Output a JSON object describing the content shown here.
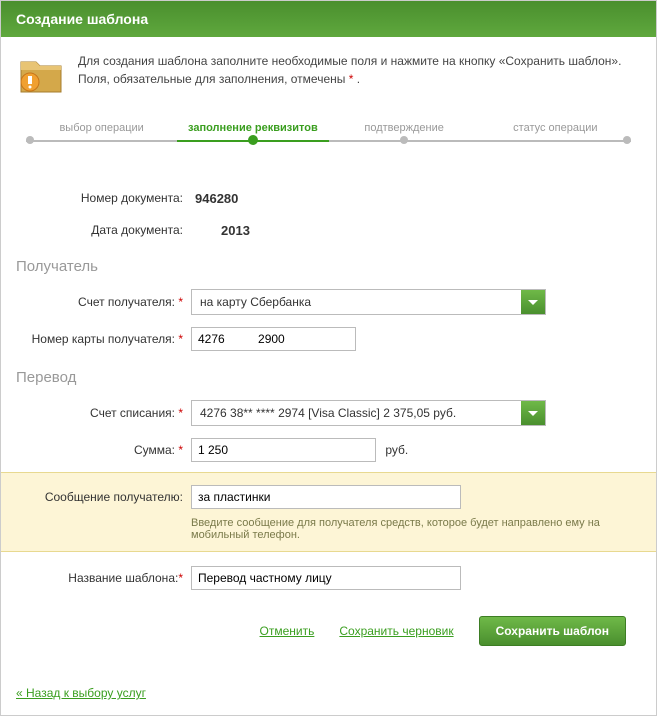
{
  "header": {
    "title": "Создание шаблона"
  },
  "intro": {
    "line1": "Для создания шаблона заполните необходимые поля и нажмите на кнопку «Сохранить шаблон».",
    "line2_a": "Поля, обязательные для заполнения, отмечены ",
    "line2_b": "*",
    "line2_c": " ."
  },
  "steps": {
    "s1": "выбор операции",
    "s2": "заполнение реквизитов",
    "s3": "подтверждение",
    "s4": "статус операции"
  },
  "form": {
    "doc_number_label": "Номер документа:",
    "doc_number_value": "946280",
    "doc_date_label": "Дата документа:",
    "doc_date_value": "2013",
    "recipient_section": "Получатель",
    "recipient_account_label": "Счет получателя:",
    "recipient_account_value": "на карту Сбербанка",
    "recipient_card_label": "Номер карты получателя:",
    "recipient_card_value": "4276          2900",
    "transfer_section": "Перевод",
    "debit_account_label": "Счет списания:",
    "debit_account_value": "4276 38** **** 2974  [Visa Classic] 2 375,05  руб.",
    "amount_label": "Сумма:",
    "amount_value": "1 250",
    "amount_currency": "руб.",
    "message_label": "Сообщение получателю:",
    "message_value": "за пластинки",
    "message_hint": "Введите сообщение для получателя средств, которое будет направлено ему на мобильный телефон.",
    "template_name_label": "Название шаблона:",
    "template_name_value": "Перевод частному лицу",
    "required_mark": "*"
  },
  "actions": {
    "cancel": "Отменить",
    "save_draft": "Сохранить черновик",
    "save_template": "Сохранить шаблон"
  },
  "back_link": "« Назад к выбору услуг"
}
